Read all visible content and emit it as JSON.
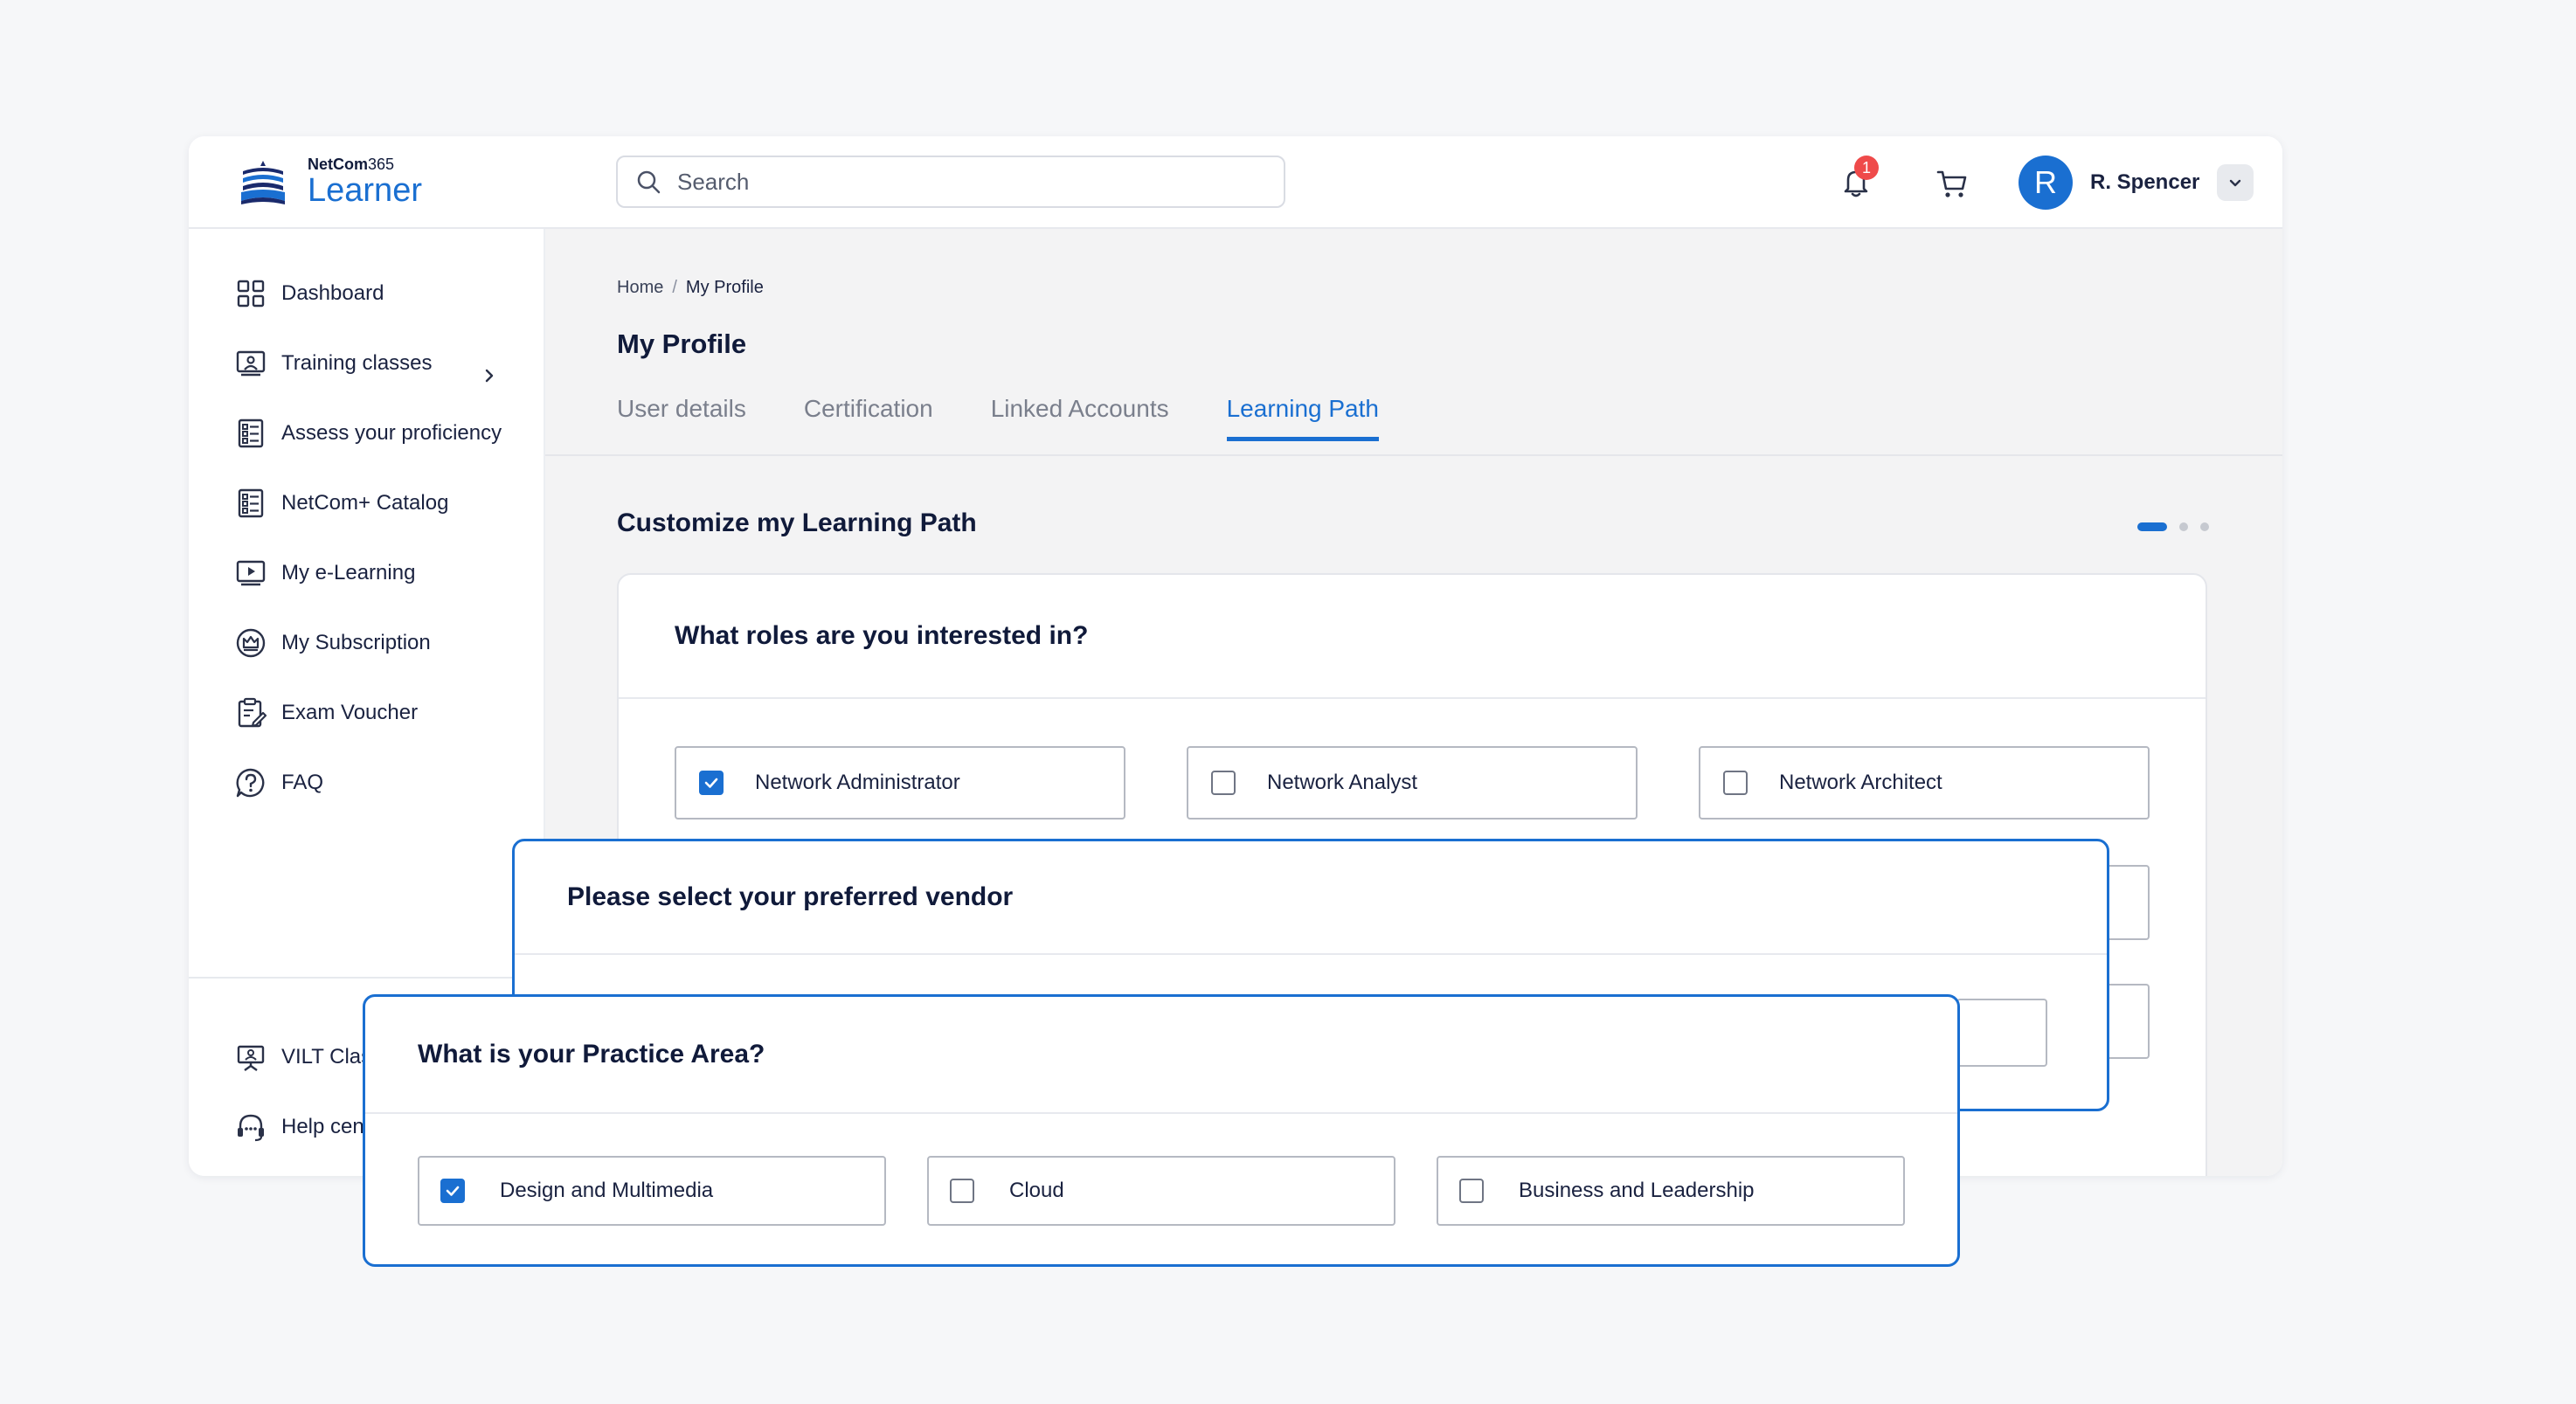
{
  "brand": {
    "name_bold": "NetCom",
    "name_suffix": "365",
    "product": "Learner",
    "accent": "#1a6fd1"
  },
  "search": {
    "placeholder": "Search"
  },
  "notifications": {
    "count": "1"
  },
  "user": {
    "initial": "R",
    "name": "R. Spencer"
  },
  "sidebar": {
    "items": [
      {
        "label": "Dashboard",
        "icon": "grid-icon"
      },
      {
        "label": "Training classes",
        "icon": "presentation-icon"
      },
      {
        "label": "Assess your proficiency",
        "icon": "checklist-icon"
      },
      {
        "label": "NetCom+ Catalog",
        "icon": "checklist-icon"
      },
      {
        "label": "My e-Learning",
        "icon": "play-screen-icon"
      },
      {
        "label": "My Subscription",
        "icon": "crown-icon"
      },
      {
        "label": "Exam Voucher",
        "icon": "clipboard-edit-icon"
      },
      {
        "label": "FAQ",
        "icon": "question-icon"
      }
    ],
    "bottom_items": [
      {
        "label": "VILT Class Prep",
        "icon": "easel-icon"
      },
      {
        "label": "Help center",
        "icon": "headset-icon"
      }
    ]
  },
  "breadcrumb": {
    "home": "Home",
    "separator": "/",
    "current": "My Profile"
  },
  "page": {
    "title": "My Profile"
  },
  "tabs": [
    {
      "label": "User details",
      "active": false
    },
    {
      "label": "Certification",
      "active": false
    },
    {
      "label": "Linked Accounts",
      "active": false
    },
    {
      "label": "Learning Path",
      "active": true
    }
  ],
  "section": {
    "title": "Customize my Learning Path",
    "step": 1,
    "steps": 3
  },
  "roles_card": {
    "question": "What roles are you interested in?",
    "options": [
      {
        "label": "Network Administrator",
        "checked": true
      },
      {
        "label": "Network Analyst",
        "checked": false
      },
      {
        "label": "Network Architect",
        "checked": false
      }
    ]
  },
  "vendor_card": {
    "question": "Please select your preferred vendor"
  },
  "practice_card": {
    "question": "What is your Practice Area?",
    "options": [
      {
        "label": "Design and Multimedia",
        "checked": true
      },
      {
        "label": "Cloud",
        "checked": false
      },
      {
        "label": "Business and Leadership",
        "checked": false
      }
    ]
  }
}
